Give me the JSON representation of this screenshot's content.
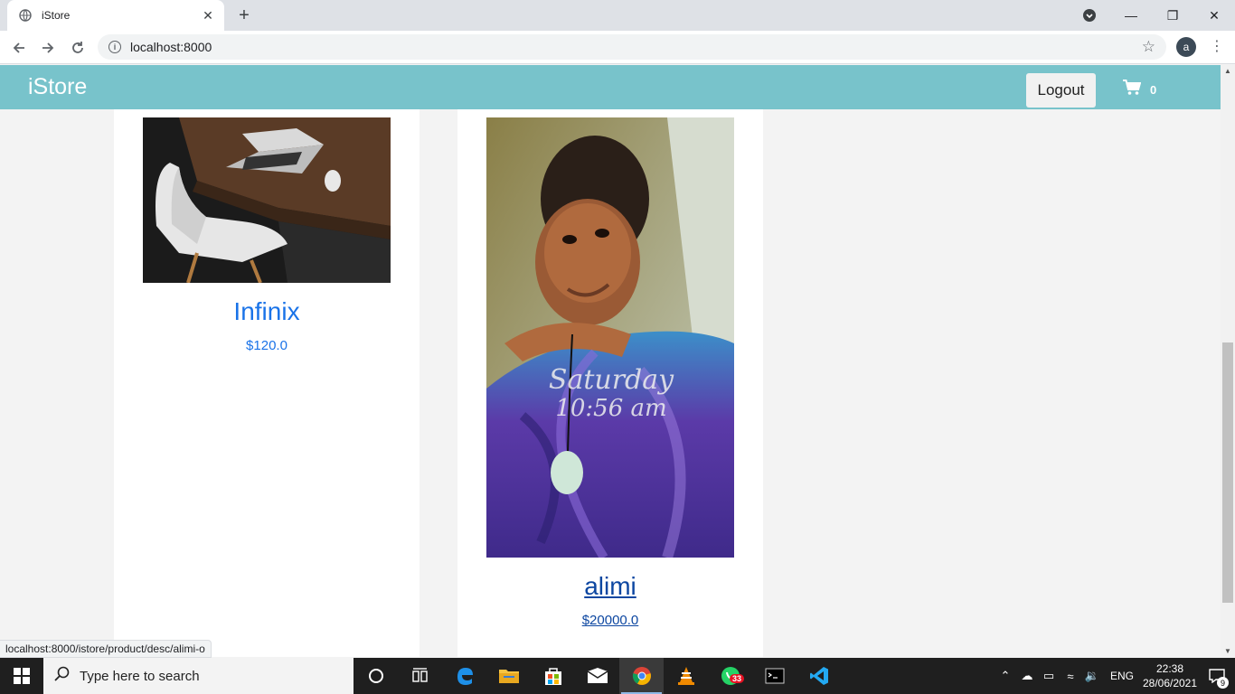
{
  "browser": {
    "tab_title": "iStore",
    "tab_close": "✕",
    "new_tab": "+",
    "url": "localhost:8000",
    "profile_initial": "a",
    "status_url": "localhost:8000/istore/product/desc/alimi-o"
  },
  "navbar": {
    "brand": "iStore",
    "logout_label": "Logout",
    "cart_count": "0",
    "accent_color": "#78c3cb"
  },
  "products": [
    {
      "name": "Infinix",
      "price": "$120.0"
    },
    {
      "name": "alimi",
      "price": "$20000.0"
    }
  ],
  "taskbar": {
    "search_placeholder": "Type here to search",
    "whatsapp_badge": "33",
    "language": "ENG",
    "time": "22:38",
    "date": "28/06/2021",
    "notification_count": "9"
  }
}
